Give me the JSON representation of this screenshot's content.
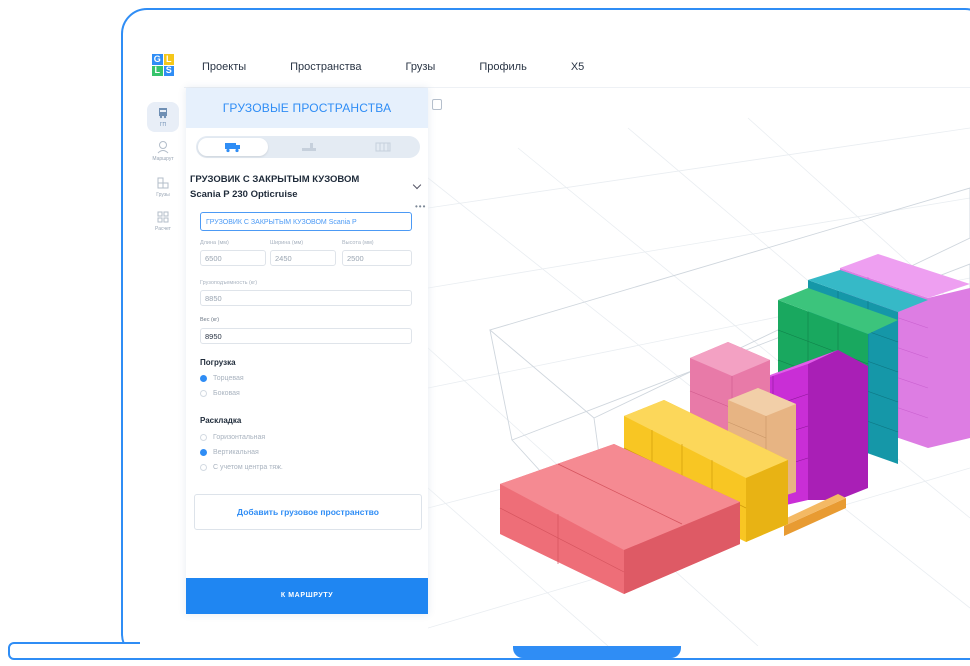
{
  "logo": {
    "letters": [
      "G",
      "L",
      "L",
      "S"
    ]
  },
  "nav": {
    "items": [
      "Проекты",
      "Пространства",
      "Грузы",
      "Профиль",
      "X5"
    ]
  },
  "rail": {
    "items": [
      "ГП",
      "Маршрут",
      "Грузы",
      "Расчет"
    ]
  },
  "panel": {
    "title": "ГРУЗОВЫЕ ПРОСТРАНСТВА",
    "vehicle_type": "ГРУЗОВИК С ЗАКРЫТЫМ КУЗОВОМ",
    "vehicle_model": "Scania P 230 Opticruise",
    "more": "•••",
    "name_value": "ГРУЗОВИК С ЗАКРЫТЫМ КУЗОВОМ Scania P",
    "length_label": "Длина (мм)",
    "length_value": "6500",
    "width_label": "Ширина (мм)",
    "width_value": "2450",
    "height_label": "Высота (мм)",
    "height_value": "2500",
    "capacity_label": "Грузоподъемность (кг)",
    "capacity_value": "8850",
    "weight_label": "Вес (кг)",
    "weight_value": "8950",
    "loading_title": "Погрузка",
    "loading_options": [
      "Торцевая",
      "Боковая"
    ],
    "loading_selected": "Торцевая",
    "layout_title": "Раскладка",
    "layout_options": [
      "Горизонтальная",
      "Вертикальная",
      "С учетом центра тяж."
    ],
    "layout_selected": "Вертикальная",
    "add_button": "Добавить грузовое пространство",
    "route_button": "К МАРШРУТУ"
  },
  "colors": {
    "accent": "#2f8df5",
    "cargo_red": "#ee6e78",
    "cargo_yellow": "#f8c623",
    "cargo_pink": "#e87aa8",
    "cargo_tan": "#e7b483",
    "cargo_magenta": "#c92ed6",
    "cargo_green": "#19a85f",
    "cargo_teal": "#1597a8",
    "cargo_violet": "#dd7de3",
    "pallet": "#e89b32"
  }
}
